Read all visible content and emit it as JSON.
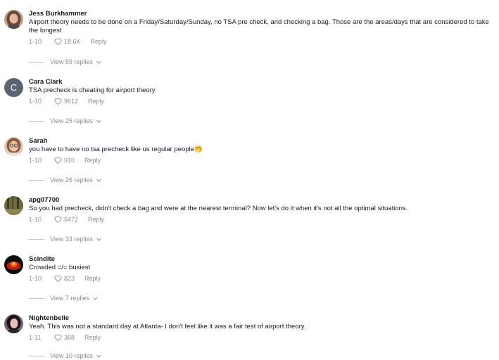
{
  "comments": [
    {
      "username": "Jess Burkhammer",
      "text": "Airport theory needs to be done on a Friday/Saturday/Sunday, no TSA pre check, and checking a bag. Those are the areas/days that are considered to take the longest",
      "date": "1-10",
      "likes": "18.6K",
      "reply_label": "Reply",
      "view_replies": "View 59 replies",
      "avatar_icon": "profile-photo-woman-brown-hair"
    },
    {
      "username": "Cara Clark",
      "text": "TSA precheck is cheating for airport theory",
      "date": "1-10",
      "likes": "9612",
      "reply_label": "Reply",
      "view_replies": "View 25 replies",
      "avatar_letter": "C"
    },
    {
      "username": "Sarah",
      "text": "you have to have no tsa precheck like us regular people🤭",
      "date": "1-10",
      "likes": "910",
      "reply_label": "Reply",
      "view_replies": "View 26 replies",
      "avatar_icon": "profile-photo-woman-glasses"
    },
    {
      "username": "apg07700",
      "text": "So you had precheck, didn't check a bag and were at the nearest terminal? Now let's do it when it's not all the optimal situations.",
      "date": "1-10",
      "likes": "6472",
      "reply_label": "Reply",
      "view_replies": "View 33 replies",
      "avatar_icon": "profile-photo-forest"
    },
    {
      "username": "Scindite",
      "text": "Crowded =/= busiest",
      "date": "1-10",
      "likes": "823",
      "reply_label": "Reply",
      "view_replies": "View 7 replies",
      "avatar_icon": "profile-photo-red-fire"
    },
    {
      "username": "Nightenbelle",
      "text": "Yeah. This was not a standard day at Atlanta- I don't feel like it was a fair test of airport theory.",
      "date": "1-11",
      "likes": "368",
      "reply_label": "Reply",
      "view_replies": "View 10 replies",
      "avatar_icon": "profile-photo-woman-dark-hair"
    }
  ],
  "colors": {
    "text": "#161823",
    "meta": "#8a8b91",
    "avatar_letter_bg": "#5b6473"
  }
}
